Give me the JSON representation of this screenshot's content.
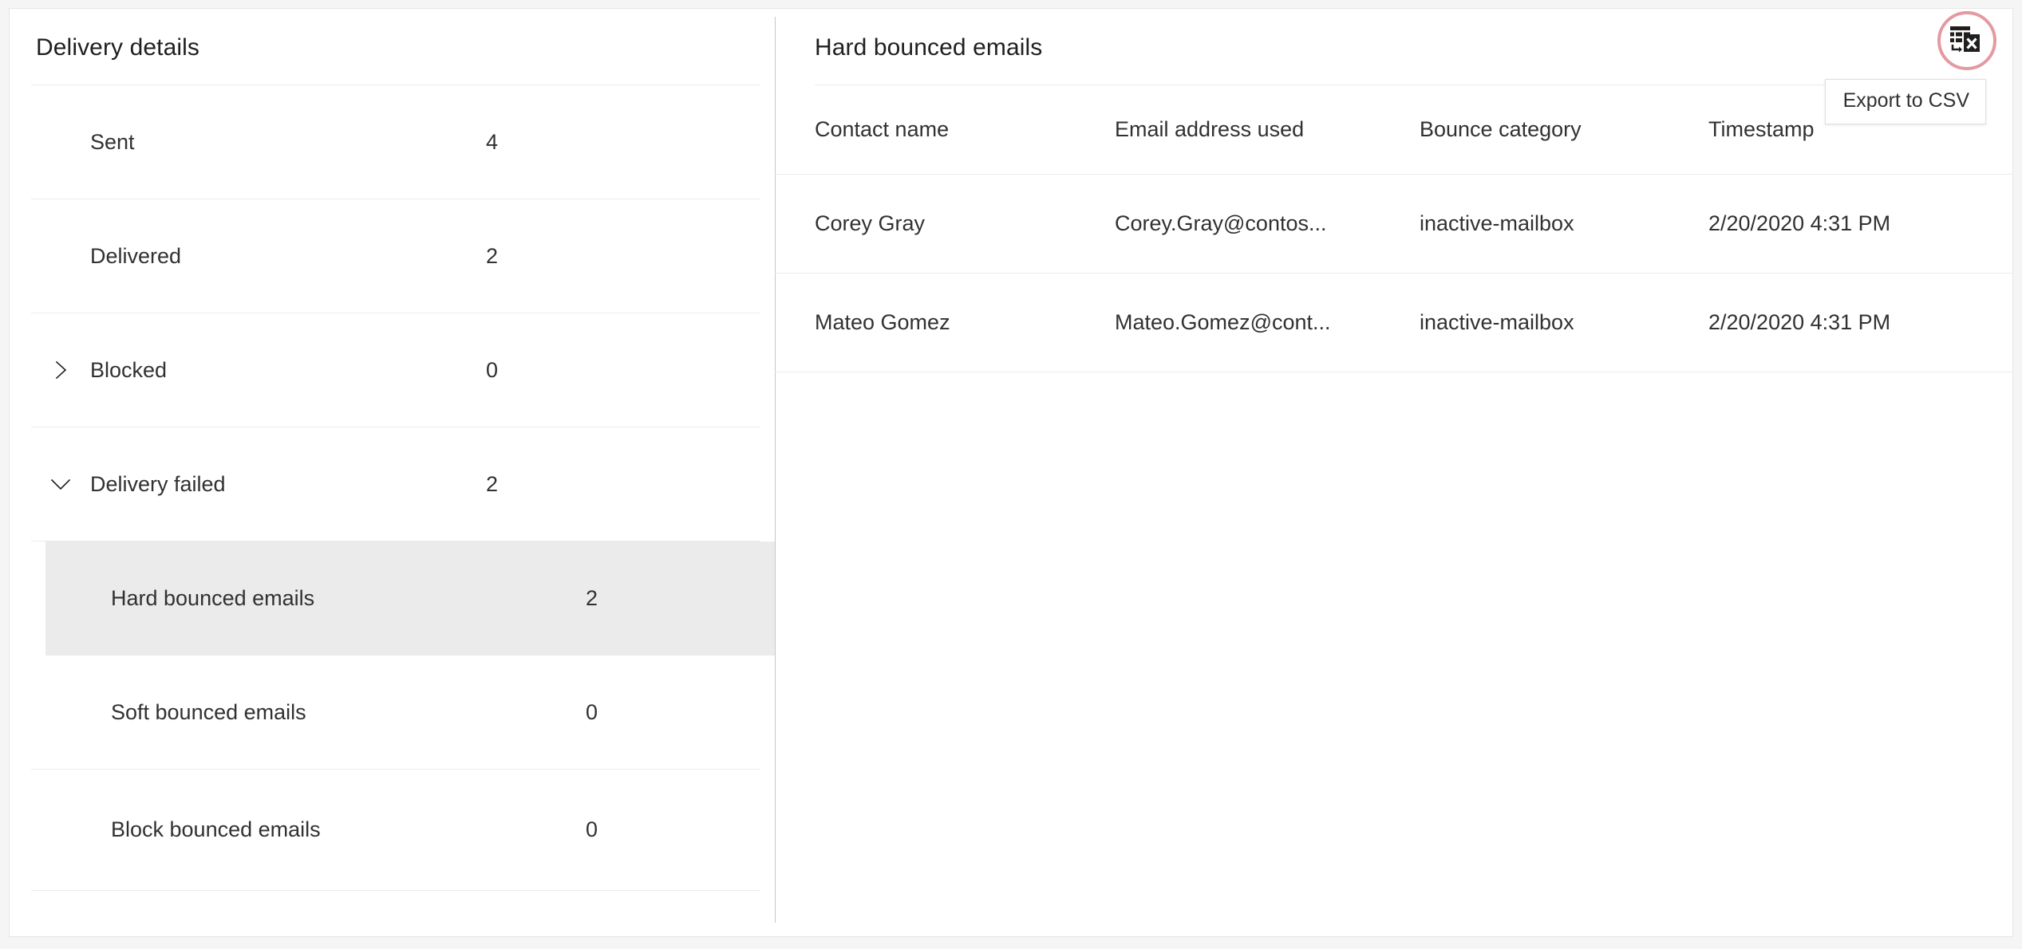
{
  "left_panel": {
    "title": "Delivery details",
    "rows": [
      {
        "label": "Sent",
        "value": "4",
        "chevron": "none",
        "level": "top",
        "selected": false
      },
      {
        "label": "Delivered",
        "value": "2",
        "chevron": "none",
        "level": "top",
        "selected": false
      },
      {
        "label": "Blocked",
        "value": "0",
        "chevron": "chevron-right-icon",
        "level": "top",
        "selected": false
      },
      {
        "label": "Delivery failed",
        "value": "2",
        "chevron": "chevron-down-icon",
        "level": "top",
        "selected": false
      },
      {
        "label": "Hard bounced emails",
        "value": "2",
        "chevron": "none",
        "level": "child",
        "selected": true
      },
      {
        "label": "Soft bounced emails",
        "value": "0",
        "chevron": "none",
        "level": "child",
        "selected": false
      },
      {
        "label": "Block bounced emails",
        "value": "0",
        "chevron": "none",
        "level": "child",
        "selected": false
      }
    ]
  },
  "right_panel": {
    "title": "Hard bounced emails",
    "export_button": {
      "icon": "export-to-excel-icon",
      "tooltip": "Export to CSV",
      "highlight_color": "#e39aa0"
    },
    "table": {
      "columns": [
        "Contact name",
        "Email address used",
        "Bounce category",
        "Timestamp"
      ],
      "rows": [
        {
          "contact_name": "Corey Gray",
          "email_address_used": "Corey.Gray@contos...",
          "bounce_category": "inactive-mailbox",
          "timestamp": "2/20/2020 4:31 PM"
        },
        {
          "contact_name": "Mateo Gomez",
          "email_address_used": "Mateo.Gomez@cont...",
          "bounce_category": "inactive-mailbox",
          "timestamp": "2/20/2020 4:31 PM"
        }
      ]
    }
  },
  "theme": {
    "selected_row_bg": "#ebebeb",
    "divider": "#edebe9",
    "text": "#323130",
    "page_bg": "#f5f5f5",
    "card_bg": "#ffffff"
  }
}
